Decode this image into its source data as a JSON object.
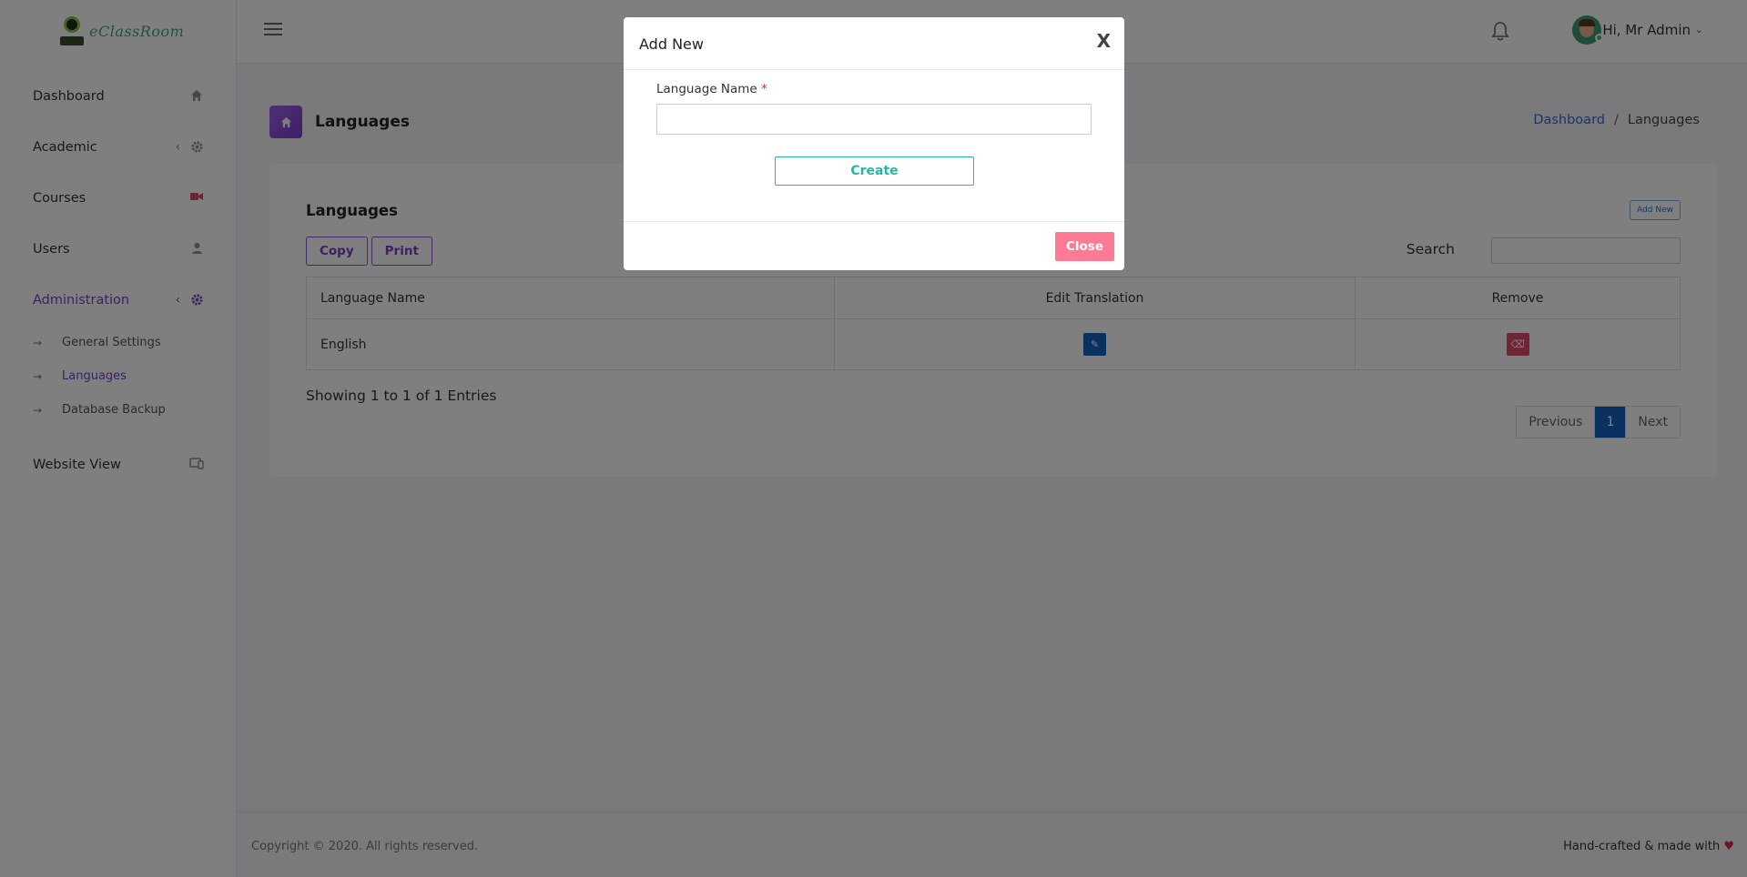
{
  "brand": {
    "name": "eClassRoom"
  },
  "sidebar": {
    "items": [
      {
        "label": "Dashboard",
        "icon": "home-icon"
      },
      {
        "label": "Academic",
        "icon": "gear-icon"
      },
      {
        "label": "Courses",
        "icon": "video-icon"
      },
      {
        "label": "Users",
        "icon": "user-icon"
      },
      {
        "label": "Administration",
        "icon": "gear-icon"
      }
    ],
    "admin_sub": [
      {
        "label": "General Settings"
      },
      {
        "label": "Languages"
      },
      {
        "label": "Database Backup"
      }
    ],
    "website": {
      "label": "Website View",
      "icon": "devices-icon"
    }
  },
  "topbar": {
    "greeting": "Hi, Mr Admin"
  },
  "page": {
    "title": "Languages",
    "breadcrumb": {
      "home": "Dashboard",
      "current": "Languages"
    }
  },
  "card": {
    "title": "Languages",
    "add_new": "Add New",
    "copy": "Copy",
    "print": "Print",
    "search_label": "Search",
    "search_value": ""
  },
  "table": {
    "headers": [
      "Language Name",
      "Edit Translation",
      "Remove"
    ],
    "rows": [
      {
        "name": "English"
      }
    ]
  },
  "pagination": {
    "info": "Showing 1 to 1 of 1 Entries",
    "previous": "Previous",
    "current": "1",
    "next": "Next"
  },
  "footer": {
    "copyright": "Copyright © 2020. All rights reserved.",
    "made_with": "Hand-crafted & made with"
  },
  "modal": {
    "title": "Add New",
    "close_x": "X",
    "field_label": "Language Name",
    "required_mark": "*",
    "field_value": "",
    "create": "Create",
    "close": "Close"
  },
  "colors": {
    "accent": "#7a3fcf",
    "primary": "#1565c0",
    "teal": "#26b6a5",
    "danger": "#ff7a95"
  }
}
